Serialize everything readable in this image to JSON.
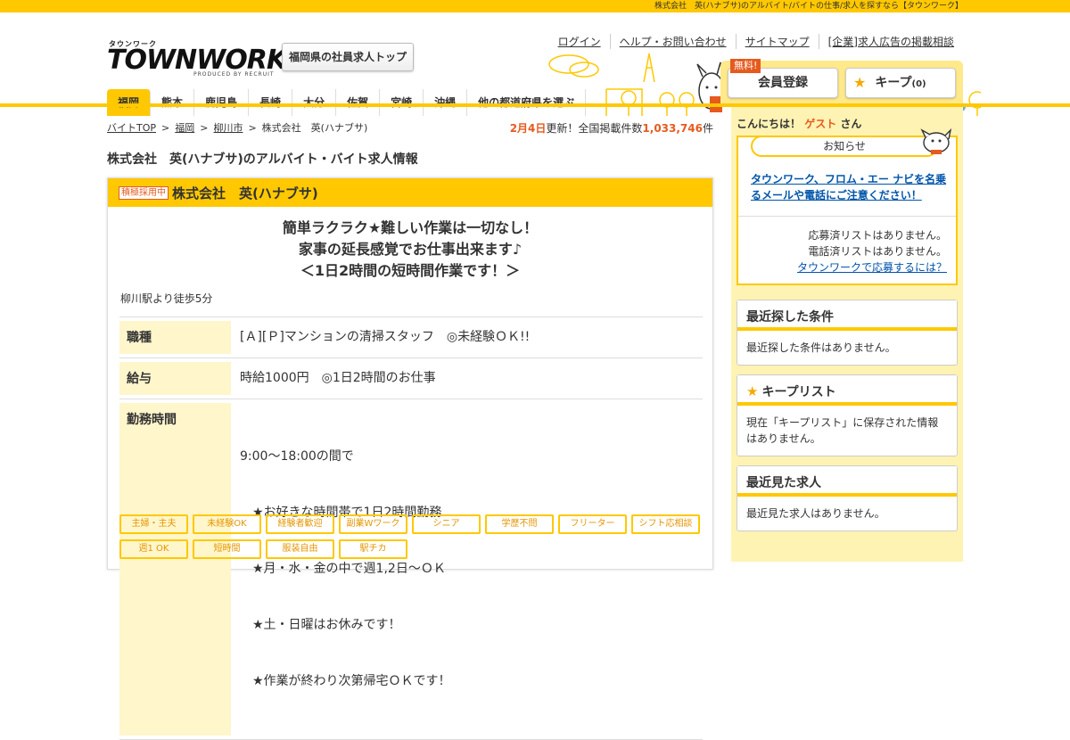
{
  "topbar": {
    "text": "株式会社　英(ハナブサ)のアルバイト/バイトの仕事/求人を探すなら【タウンワーク】"
  },
  "logo": {
    "kana": "タウンワーク",
    "word": "TOWNWORK",
    "by": "PRODUCED BY RECRUIT"
  },
  "header": {
    "pref_top": "福岡県の社員求人トップ",
    "links": [
      "ログイン",
      "ヘルプ・お問い合わせ",
      "サイトマップ",
      "[企業]求人広告の掲載相談"
    ],
    "free_badge": "無料!",
    "register": "会員登録",
    "keep": "キープ",
    "keep_count": "(0)"
  },
  "tabs": [
    "福岡",
    "熊本",
    "鹿児島",
    "長崎",
    "大分",
    "佐賀",
    "宮崎",
    "沖縄",
    "他の都道府県を選ぶ"
  ],
  "breadcrumb": [
    "バイトTOP",
    "福岡",
    "柳川市",
    "株式会社　英(ハナブサ)"
  ],
  "update": {
    "date": "2月4日",
    "mid": "更新！全国掲載件数",
    "count": "1,033,746",
    "suffix": "件"
  },
  "page_title": "株式会社　英(ハナブサ)のアルバイト・バイト求人情報",
  "job": {
    "tag": "積極採用中",
    "company": "株式会社　英(ハナブサ)",
    "catch": [
      "簡単ラクラク★難しい作業は一切なし！",
      "家事の延長感覚でお仕事出来ます♪",
      "＜1日2時間の短時間作業です！＞"
    ],
    "station": "柳川駅より徒歩5分",
    "rows": [
      {
        "label": "職種",
        "lines": [
          "[Ａ][Ｐ]マンションの清掃スタッフ　◎未経験ＯＫ!!"
        ]
      },
      {
        "label": "給与",
        "lines": [
          "時給1000円　◎1日2時間のお仕事"
        ]
      },
      {
        "label": "勤務時間",
        "lines": [
          "9:00～18:00の間で",
          "　★お好きな時間帯で1日2時間勤務",
          "　★月・水・金の中で週1,2日～ＯＫ",
          "　★土・日曜はお休みです！",
          "　★作業が終わり次第帰宅ＯＫです！"
        ]
      }
    ],
    "chips": [
      "主婦・主夫",
      "未経験OK",
      "経験者歓迎",
      "副業Wワーク",
      "シニア",
      "学歴不問",
      "フリーター",
      "シフト応相談",
      "週1 OK",
      "短時間",
      "服装自由",
      "駅チカ"
    ]
  },
  "sidebar": {
    "hello": "こんにちは！",
    "guest": "ゲスト",
    "san": "さん",
    "notice_title": "お知らせ",
    "notice_link": "タウンワーク、フロム・エー ナビを名乗るメールや電話にご注意ください！",
    "notice_lines": [
      "応募済リストはありません。",
      "電話済リストはありません。"
    ],
    "notice_help": "タウンワークで応募するには？",
    "recent_search_title": "最近探した条件",
    "recent_search_body": "最近探した条件はありません。",
    "keep_title": "キープリスト",
    "keep_body": "現在「キープリスト」に保存された情報はありません。",
    "recent_view_title": "最近見た求人",
    "recent_view_body": "最近見た求人はありません。"
  },
  "colors": {
    "accent": "#ffc800",
    "highlight": "#e65a1e",
    "link": "#0055aa"
  }
}
